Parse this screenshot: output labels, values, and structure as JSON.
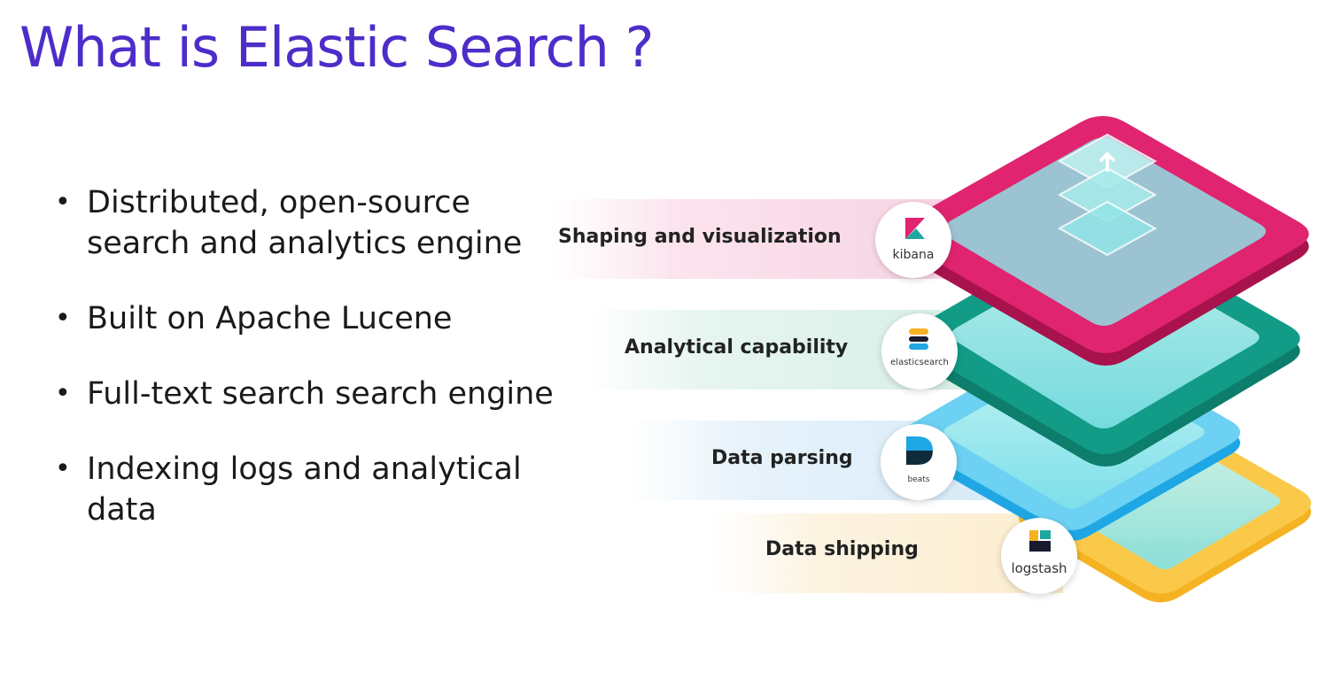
{
  "slide": {
    "title": "What is Elastic Search ?",
    "bullets": [
      "Distributed, open-source search and analytics engine",
      "Built on Apache Lucene",
      "Full-text search search engine",
      "Indexing logs and analytical data"
    ]
  },
  "diagram": {
    "layers": [
      {
        "label": "Shaping and visualization",
        "logo_text": "kibana",
        "color": "#e0246f",
        "logo_icon": "kibana-icon"
      },
      {
        "label": "Analytical capability",
        "logo_text": "elasticsearch",
        "color": "#129b86",
        "logo_icon": "elasticsearch-icon"
      },
      {
        "label": "Data parsing",
        "logo_text": "beats",
        "color": "#1ea7e4",
        "logo_icon": "beats-icon"
      },
      {
        "label": "Data shipping",
        "logo_text": "logstash",
        "color": "#f5b324",
        "logo_icon": "logstash-icon"
      }
    ],
    "accent_colors": {
      "title": "#4d2dc9",
      "kibana": "#e0246f",
      "elasticsearch": "#129b86",
      "beats": "#1ea7e4",
      "logstash": "#f5b324"
    }
  }
}
